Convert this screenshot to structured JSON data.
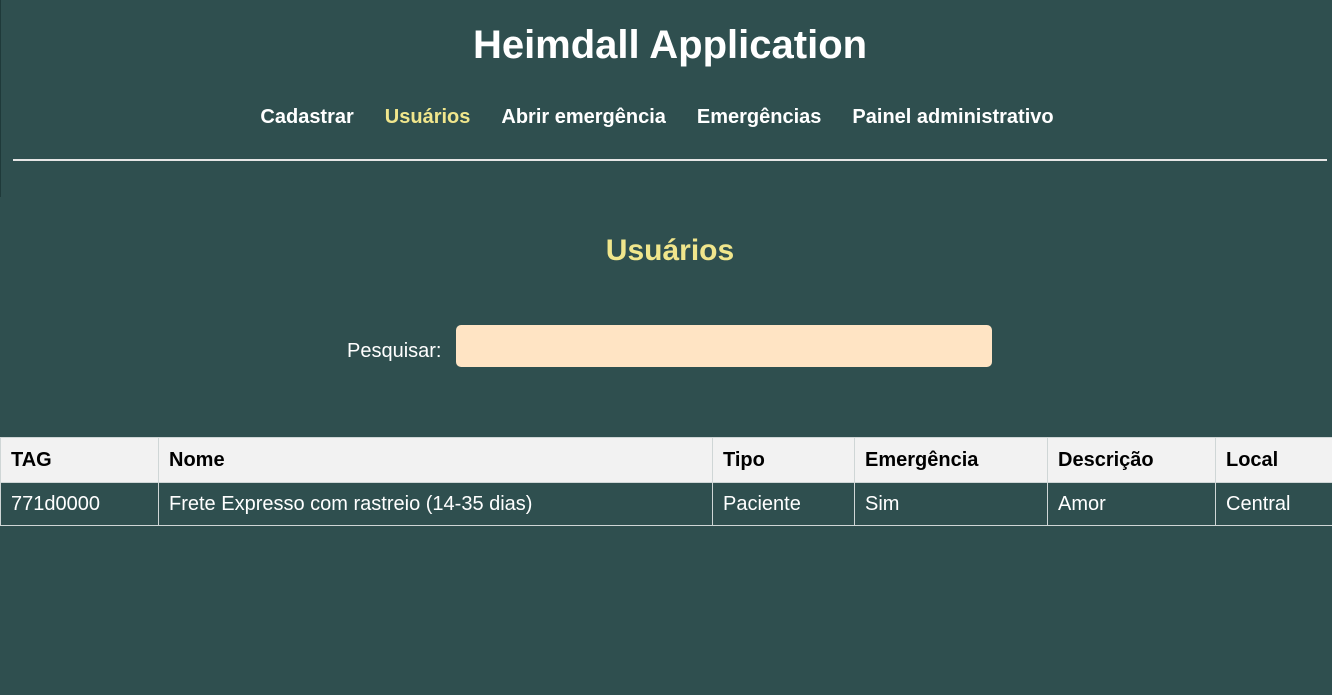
{
  "app": {
    "title": "Heimdall Application"
  },
  "nav": {
    "items": [
      {
        "label": "Cadastrar",
        "active": false
      },
      {
        "label": "Usuários",
        "active": true
      },
      {
        "label": "Abrir emergência",
        "active": false
      },
      {
        "label": "Emergências",
        "active": false
      },
      {
        "label": "Painel administrativo",
        "active": false
      }
    ]
  },
  "page": {
    "title": "Usuários"
  },
  "search": {
    "label": "Pesquisar:",
    "value": "",
    "placeholder": ""
  },
  "table": {
    "headers": [
      "TAG",
      "Nome",
      "Tipo",
      "Emergência",
      "Descrição",
      "Local"
    ],
    "rows": [
      [
        "771d0000",
        "Frete Expresso com rastreio (14-35 dias)",
        "Paciente",
        "Sim",
        "Amor",
        "Central"
      ]
    ]
  },
  "colors": {
    "background": "#2f4f4f",
    "accent": "#f0e68c",
    "input_background": "#ffe4c4",
    "header_row_background": "#f2f2f2"
  }
}
